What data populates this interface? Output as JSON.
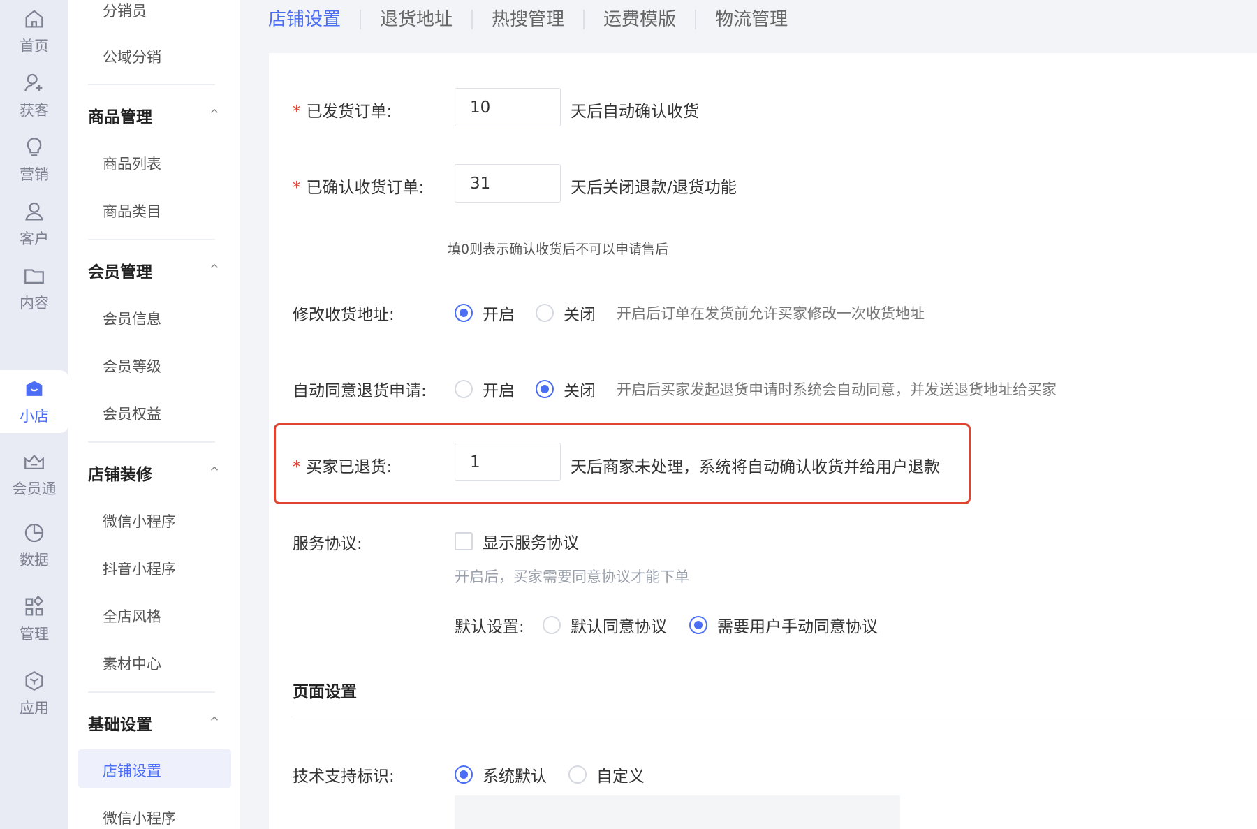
{
  "rail": {
    "items": [
      {
        "label": "首页",
        "icon": "home-icon"
      },
      {
        "label": "获客",
        "icon": "user-add-icon"
      },
      {
        "label": "营销",
        "icon": "bulb-icon"
      },
      {
        "label": "客户",
        "icon": "user-icon"
      },
      {
        "label": "内容",
        "icon": "folder-icon"
      },
      {
        "label": "小店",
        "icon": "shop-icon",
        "active": true
      },
      {
        "label": "会员通",
        "icon": "crown-icon"
      },
      {
        "label": "数据",
        "icon": "pie-chart-icon"
      },
      {
        "label": "管理",
        "icon": "grid-icon"
      },
      {
        "label": "应用",
        "icon": "cube-icon"
      }
    ]
  },
  "submenu": {
    "top_items": [
      "分销员",
      "公域分销"
    ],
    "groups": [
      {
        "title": "商品管理",
        "items": [
          "商品列表",
          "商品类目"
        ]
      },
      {
        "title": "会员管理",
        "items": [
          "会员信息",
          "会员等级",
          "会员权益"
        ]
      },
      {
        "title": "店铺装修",
        "items": [
          "微信小程序",
          "抖音小程序",
          "全店风格",
          "素材中心"
        ]
      },
      {
        "title": "基础设置",
        "items": [
          "店铺设置",
          "微信小程序"
        ]
      }
    ]
  },
  "tabs": [
    "店铺设置",
    "退货地址",
    "热搜管理",
    "运费模版",
    "物流管理"
  ],
  "form": {
    "shipped_label": "已发货订单:",
    "shipped_value": "10",
    "shipped_after": "天后自动确认收货",
    "confirmed_label": "已确认收货订单:",
    "confirmed_value": "31",
    "confirmed_after": "天后关闭退款/退货功能",
    "confirmed_hint": "填0则表示确认收货后不可以申请售后",
    "modify_addr_label": "修改收货地址:",
    "modify_addr_on": "开启",
    "modify_addr_off": "关闭",
    "modify_addr_desc": "开启后订单在发货前允许买家修改一次收货地址",
    "auto_agree_label": "自动同意退货申请:",
    "auto_agree_on": "开启",
    "auto_agree_off": "关闭",
    "auto_agree_desc": "开启后买家发起退货申请时系统会自动同意，并发送退货地址给买家",
    "returned_label": "买家已退货:",
    "returned_value": "1",
    "returned_after": "天后商家未处理，系统将自动确认收货并给用户退款",
    "service_label": "服务协议:",
    "service_checkbox": "显示服务协议",
    "service_hint": "开启后，买家需要同意协议才能下单",
    "default_label": "默认设置:",
    "default_opt1": "默认同意协议",
    "default_opt2": "需要用户手动同意协议",
    "page_section": "页面设置",
    "tech_label": "技术支持标识:",
    "tech_opt1": "系统默认",
    "tech_opt2": "自定义"
  },
  "colors": {
    "accent": "#4c6ef5",
    "highlight": "#e0432f",
    "required": "#e03b2a"
  }
}
